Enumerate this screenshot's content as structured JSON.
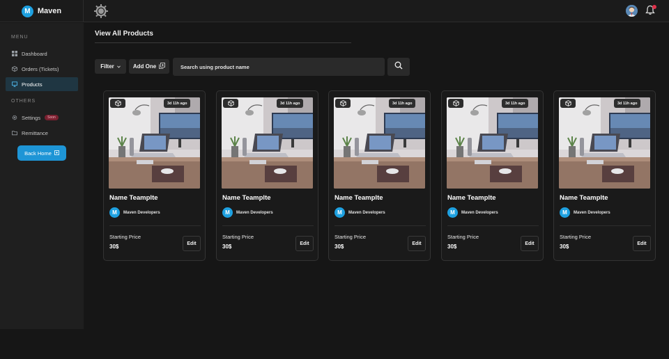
{
  "app": {
    "brand_letter": "M",
    "brand_name": "Maven"
  },
  "sidebar": {
    "menu_label": "MENU",
    "others_label": "OTHERS",
    "items": [
      {
        "label": "Dashboard",
        "icon": "grid-icon",
        "active": false
      },
      {
        "label": "Orders (Tickets)",
        "icon": "box-icon",
        "active": false
      },
      {
        "label": "Products",
        "icon": "monitor-icon",
        "active": true
      },
      {
        "label": "Settings",
        "icon": "gear-icon",
        "badge": "Soon",
        "active": false
      },
      {
        "label": "Remittance",
        "icon": "folder-icon",
        "active": false
      }
    ],
    "back_home_label": "Back Home"
  },
  "main": {
    "title": "View All Products",
    "filter_label": "Filter",
    "add_label": "Add One",
    "search_placeholder": "Search using product name"
  },
  "products": [
    {
      "name": "Name Teamplte",
      "developer_letter": "M",
      "developer": "Maven Developers",
      "time": "3d 11h ago",
      "price_label": "Starting Price",
      "price": "30$",
      "edit_label": "Edit"
    },
    {
      "name": "Name Teamplte",
      "developer_letter": "M",
      "developer": "Maven Developers",
      "time": "3d 11h ago",
      "price_label": "Starting Price",
      "price": "30$",
      "edit_label": "Edit"
    },
    {
      "name": "Name Teamplte",
      "developer_letter": "M",
      "developer": "Maven Developers",
      "time": "3d 11h ago",
      "price_label": "Starting Price",
      "price": "30$",
      "edit_label": "Edit"
    },
    {
      "name": "Name Teamplte",
      "developer_letter": "M",
      "developer": "Maven Developers",
      "time": "3d 11h ago",
      "price_label": "Starting Price",
      "price": "30$",
      "edit_label": "Edit"
    },
    {
      "name": "Name Teamplte",
      "developer_letter": "M",
      "developer": "Maven Developers",
      "time": "3d 11h ago",
      "price_label": "Starting Price",
      "price": "30$",
      "edit_label": "Edit"
    }
  ],
  "colors": {
    "accent": "#1ea0e0",
    "active_nav": "#1f3642",
    "soon_badge": "#7a2030"
  }
}
